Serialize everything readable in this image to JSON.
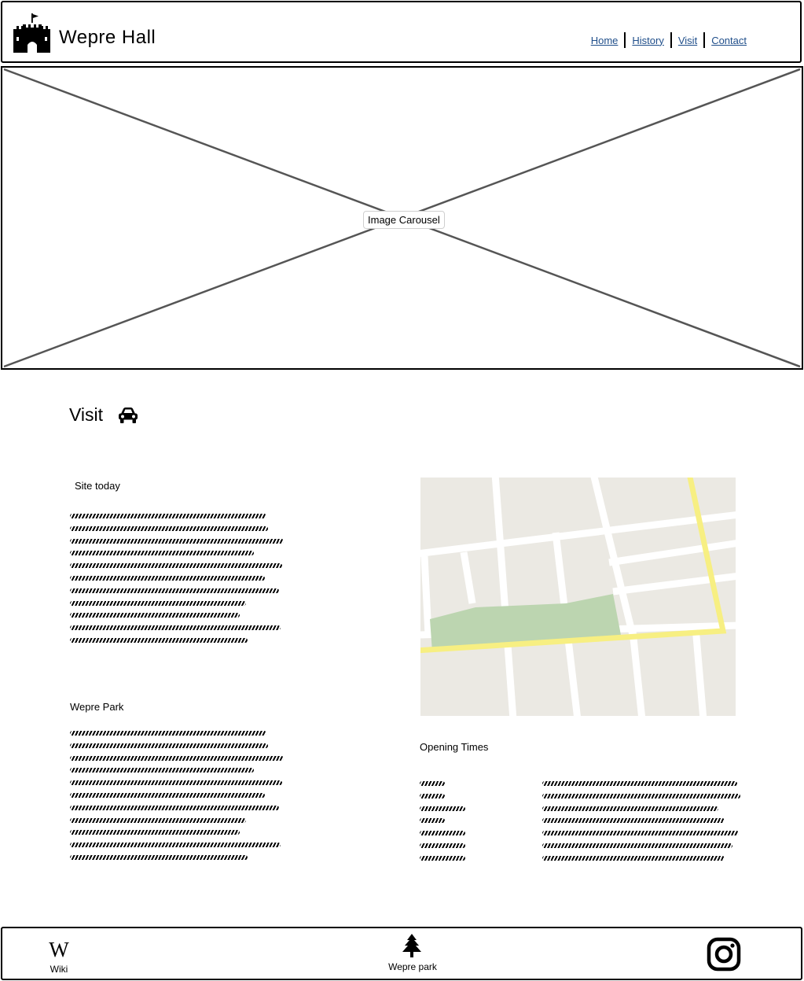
{
  "header": {
    "logo_icon": "castle-icon",
    "title": "Wepre Hall",
    "nav": [
      {
        "label": "Home"
      },
      {
        "label": "History"
      },
      {
        "label": "Visit"
      },
      {
        "label": "Contact"
      }
    ]
  },
  "hero": {
    "label": "Image Carousel"
  },
  "visit": {
    "title": "Visit",
    "icon": "car-icon",
    "site_today": {
      "heading": "Site today"
    },
    "wepre_park": {
      "heading": "Wepre Park"
    },
    "map_icon": "map-image",
    "opening_times": {
      "heading": "Opening Times"
    }
  },
  "footer": {
    "wiki": {
      "icon": "wikipedia-icon",
      "glyph": "W",
      "label": "Wiki"
    },
    "park": {
      "icon": "tree-icon",
      "label": "Wepre park"
    },
    "social": {
      "icon": "instagram-icon"
    }
  },
  "colors": {
    "link": "#1f4e8a",
    "map_block": "#ebe9e3",
    "map_road": "#ffffff",
    "map_highlight_road": "#f7ef82",
    "map_park": "#bcd5b0"
  }
}
